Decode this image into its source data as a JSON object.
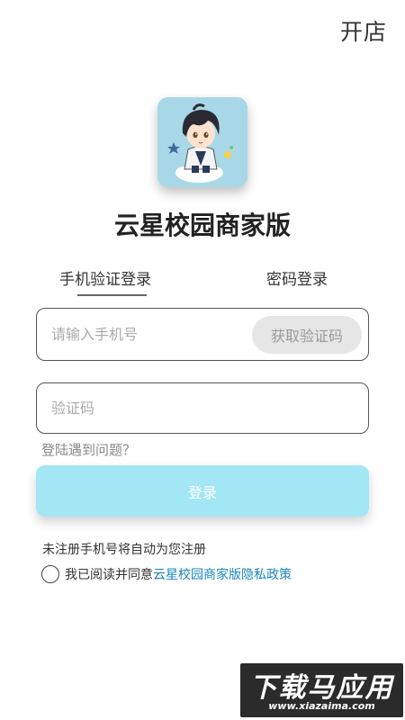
{
  "header": {
    "open_store": "开店"
  },
  "app": {
    "title": "云星校园商家版"
  },
  "tabs": [
    {
      "label": "手机验证登录",
      "active": true
    },
    {
      "label": "密码登录",
      "active": false
    }
  ],
  "form": {
    "phone_placeholder": "请输入手机号",
    "phone_value": "",
    "get_code_label": "获取验证码",
    "code_placeholder": "验证码",
    "code_value": "",
    "help_link": "登陆遇到问题？",
    "login_label": "登录"
  },
  "notice": "未注册手机号将自动为您注册",
  "agreement": {
    "checked": false,
    "prefix": "我已阅读并同意",
    "policy": "云星校园商家版隐私政策"
  },
  "watermark": {
    "main": "下载马应用",
    "url": "www.xiazaima.com"
  },
  "colors": {
    "login_button": "#a3e6f4",
    "policy_link": "#1a86b8",
    "get_code_bg": "#e6e6e6",
    "logo_bg": "#a8d8e8"
  }
}
